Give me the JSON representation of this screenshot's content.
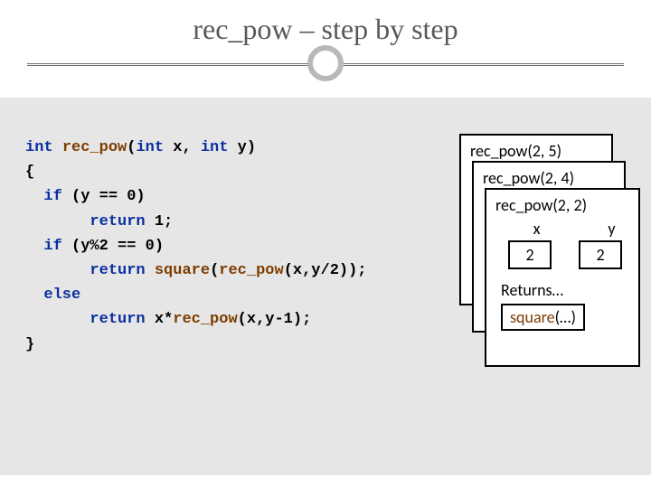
{
  "title": "rec_pow – step by step",
  "code": {
    "l1a": "int",
    "l1b": " ",
    "l1c": "rec_pow",
    "l1d": "(",
    "l1e": "int",
    "l1f": " x, ",
    "l1g": "int",
    "l1h": " y)",
    "l2": "{",
    "l3a": "  ",
    "l3b": "if",
    "l3c": " (y == 0)",
    "l4a": "       ",
    "l4b": "return",
    "l4c": " 1;",
    "l5a": "  ",
    "l5b": "if",
    "l5c": " (y%2 == 0)",
    "l6a": "       ",
    "l6b": "return",
    "l6c": " ",
    "l6d": "square",
    "l6e": "(",
    "l6f": "rec_pow",
    "l6g": "(x,y/2));",
    "l7a": "  ",
    "l7b": "else",
    "l8a": "       ",
    "l8b": "return",
    "l8c": " x*",
    "l8d": "rec_pow",
    "l8e": "(x,y-1);",
    "l9": "}"
  },
  "stack": {
    "f0": {
      "call": "rec_pow(2, 5)"
    },
    "f1": {
      "call": "rec_pow(2, 4)"
    },
    "f2": {
      "call": "rec_pow(2, 2)",
      "xlabel": "x",
      "ylabel": "y",
      "xval": "2",
      "yval": "2",
      "returns_label": "Returns…",
      "ret_fn": "square",
      "ret_rest": "(…)"
    }
  }
}
